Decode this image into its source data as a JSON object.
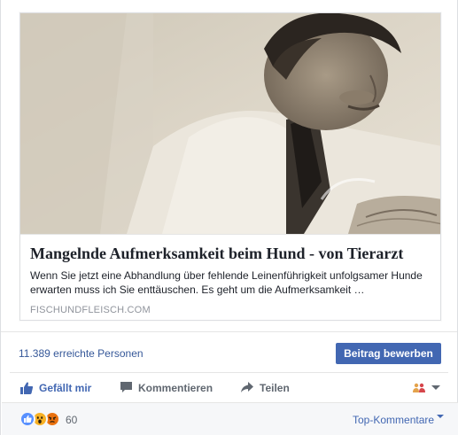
{
  "post": {
    "link_card": {
      "title": "Mangelnde Aufmerksamkeit beim Hund - von Tierarzt",
      "description": "Wenn Sie jetzt eine Abhandlung über fehlende Leinenführigkeit unfolgsamer Hunde erwarten muss ich Sie enttäuschen. Es geht um die Aufmerksamkeit …",
      "domain": "FISCHUNDFLEISCH.COM",
      "image_icon": "sepia-photo-man-in-white-coat"
    },
    "reach": {
      "text": "11.389 erreichte Personen",
      "boost_label": "Beitrag bewerben"
    },
    "actions": {
      "like_label": "Gefällt mir",
      "comment_label": "Kommentieren",
      "share_label": "Teilen",
      "audience_icon": "friends-icon"
    },
    "reactions": {
      "icons": [
        "like-icon",
        "wow-icon",
        "angry-icon"
      ],
      "count": "60",
      "sort_label": "Top-Kommentare"
    }
  },
  "colors": {
    "link_blue": "#365899",
    "button_blue": "#4267b2",
    "muted_gray": "#90949c",
    "action_gray": "#606770",
    "footer_bg": "#f6f7f9"
  }
}
